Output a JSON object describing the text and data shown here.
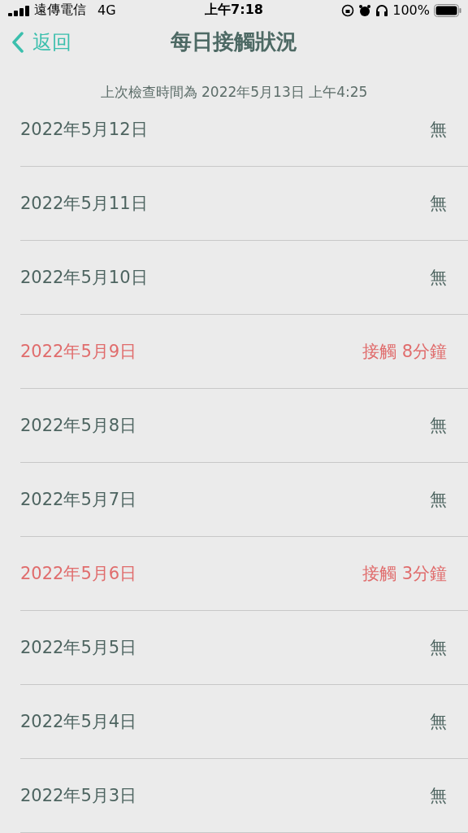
{
  "status_bar": {
    "carrier": "遠傳電信",
    "network": "4G",
    "time": "上午7:18",
    "battery": "100%"
  },
  "nav": {
    "back": "返回",
    "title": "每日接觸狀況"
  },
  "last_checked": "上次檢查時間為 2022年5月13日 上午4:25",
  "days": [
    {
      "date": "2022年5月12日",
      "result": "無",
      "alert": false
    },
    {
      "date": "2022年5月11日",
      "result": "無",
      "alert": false
    },
    {
      "date": "2022年5月10日",
      "result": "無",
      "alert": false
    },
    {
      "date": "2022年5月9日",
      "result": "接觸 8分鐘",
      "alert": true
    },
    {
      "date": "2022年5月8日",
      "result": "無",
      "alert": false
    },
    {
      "date": "2022年5月7日",
      "result": "無",
      "alert": false
    },
    {
      "date": "2022年5月6日",
      "result": "接觸 3分鐘",
      "alert": true
    },
    {
      "date": "2022年5月5日",
      "result": "無",
      "alert": false
    },
    {
      "date": "2022年5月4日",
      "result": "無",
      "alert": false
    },
    {
      "date": "2022年5月3日",
      "result": "無",
      "alert": false
    }
  ]
}
